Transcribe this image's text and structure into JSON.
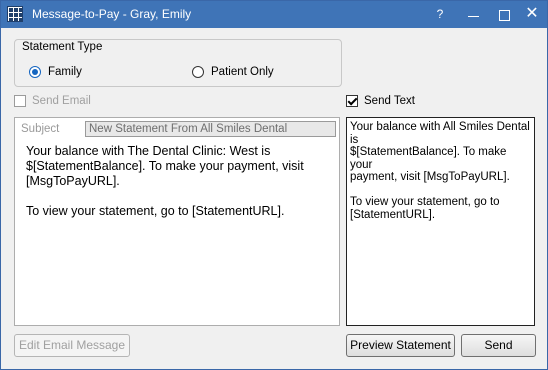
{
  "window": {
    "title": "Message-to-Pay - Gray, Emily",
    "help_label": "?",
    "close_label": "✕"
  },
  "statement_type": {
    "label": "Statement Type",
    "options": [
      {
        "label": "Family",
        "selected": true
      },
      {
        "label": "Patient Only",
        "selected": false
      }
    ]
  },
  "send_email": {
    "label": "Send Email",
    "checked": false,
    "enabled": false
  },
  "send_text": {
    "label": "Send Text",
    "checked": true
  },
  "email": {
    "subject_label": "Subject",
    "subject_value": "New Statement From All Smiles Dental",
    "body": "Your balance with The Dental Clinic: West is\n$[StatementBalance]. To make your payment, visit\n[MsgToPayURL].\n\nTo view your statement, go to [StatementURL]."
  },
  "text": {
    "body": "Your balance with All Smiles Dental is\n$[StatementBalance]. To make your\npayment, visit [MsgToPayURL].\n\nTo view your statement, go to\n[StatementURL]."
  },
  "buttons": {
    "edit_email": "Edit Email Message",
    "preview_statement": "Preview Statement",
    "send": "Send"
  }
}
